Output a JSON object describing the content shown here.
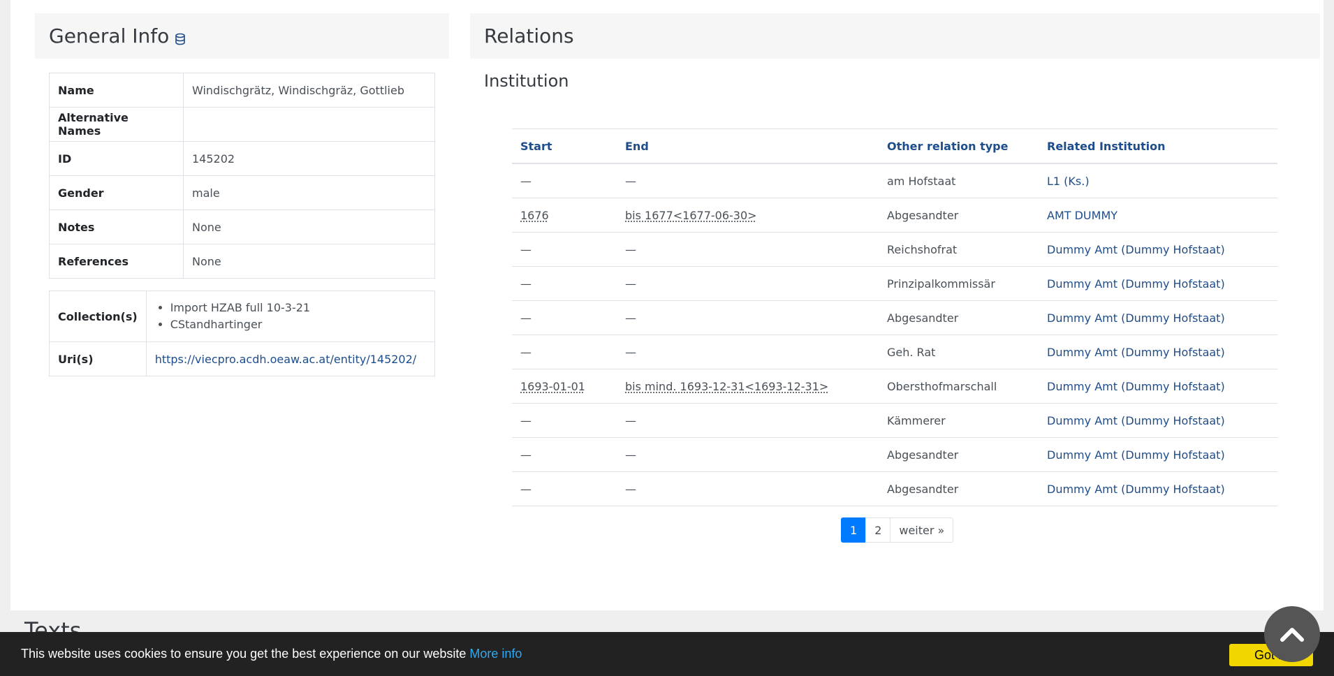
{
  "general": {
    "title": "General Info",
    "rows": [
      {
        "key": "Name",
        "value": "Windischgrätz, Windischgräz, Gottlieb"
      },
      {
        "key": "Alternative Names",
        "value": ""
      },
      {
        "key": "ID",
        "value": "145202"
      },
      {
        "key": "Gender",
        "value": "male"
      },
      {
        "key": "Notes",
        "value": "None"
      },
      {
        "key": "References",
        "value": "None"
      }
    ],
    "collections_label": "Collection(s)",
    "collections": [
      "Import HZAB full 10-3-21",
      "CStandhartinger"
    ],
    "uris_label": "Uri(s)",
    "uri": "https://viecpro.acdh.oeaw.ac.at/entity/145202/"
  },
  "relations": {
    "title": "Relations",
    "section": "Institution",
    "headers": [
      "Start",
      "End",
      "Other relation type",
      "Related Institution"
    ],
    "rows": [
      [
        "—",
        "—",
        "am Hofstaat",
        "L1 (Ks.)"
      ],
      [
        "1676",
        "bis 1677<1677-06-30>",
        "Abgesandter",
        "AMT DUMMY"
      ],
      [
        "—",
        "—",
        "Reichshofrat",
        "Dummy Amt (Dummy Hofstaat)"
      ],
      [
        "—",
        "—",
        "Prinzipalkommissär",
        "Dummy Amt (Dummy Hofstaat)"
      ],
      [
        "—",
        "—",
        "Abgesandter",
        "Dummy Amt (Dummy Hofstaat)"
      ],
      [
        "—",
        "—",
        "Geh. Rat",
        "Dummy Amt (Dummy Hofstaat)"
      ],
      [
        "1693-01-01",
        "bis mind. 1693-12-31<1693-12-31>",
        "Obersthofmarschall",
        "Dummy Amt (Dummy Hofstaat)"
      ],
      [
        "—",
        "—",
        "Kämmerer",
        "Dummy Amt (Dummy Hofstaat)"
      ],
      [
        "—",
        "—",
        "Abgesandter",
        "Dummy Amt (Dummy Hofstaat)"
      ],
      [
        "—",
        "—",
        "Abgesandter",
        "Dummy Amt (Dummy Hofstaat)"
      ]
    ],
    "pagination": {
      "pages": [
        "1",
        "2"
      ],
      "next": "weiter »",
      "current": "1"
    }
  },
  "texts": {
    "title": "Texts"
  },
  "cookie": {
    "text": "This website uses cookies to ensure you get the best experience on our website",
    "more": "More info",
    "button": "Got it!"
  },
  "icons": {
    "db": "database-icon",
    "scroll": "chevron-up-icon"
  },
  "colors": {
    "link": "#1e4d8c",
    "page_active": "#007bff",
    "cookie_bg": "#222222",
    "cookie_btn": "#f1d600",
    "cookie_link": "#31a8f0"
  }
}
